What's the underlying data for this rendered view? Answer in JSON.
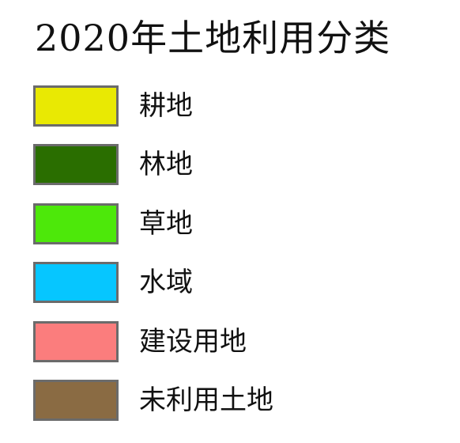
{
  "legend": {
    "title": "2020年土地利用分类",
    "items": [
      {
        "label": "耕地",
        "color": "#e9e903"
      },
      {
        "label": "林地",
        "color": "#2a6e00"
      },
      {
        "label": "草地",
        "color": "#4de80a"
      },
      {
        "label": "水域",
        "color": "#06c6ff"
      },
      {
        "label": "建设用地",
        "color": "#fb7d7d"
      },
      {
        "label": "未利用土地",
        "color": "#8a6b43"
      }
    ]
  }
}
